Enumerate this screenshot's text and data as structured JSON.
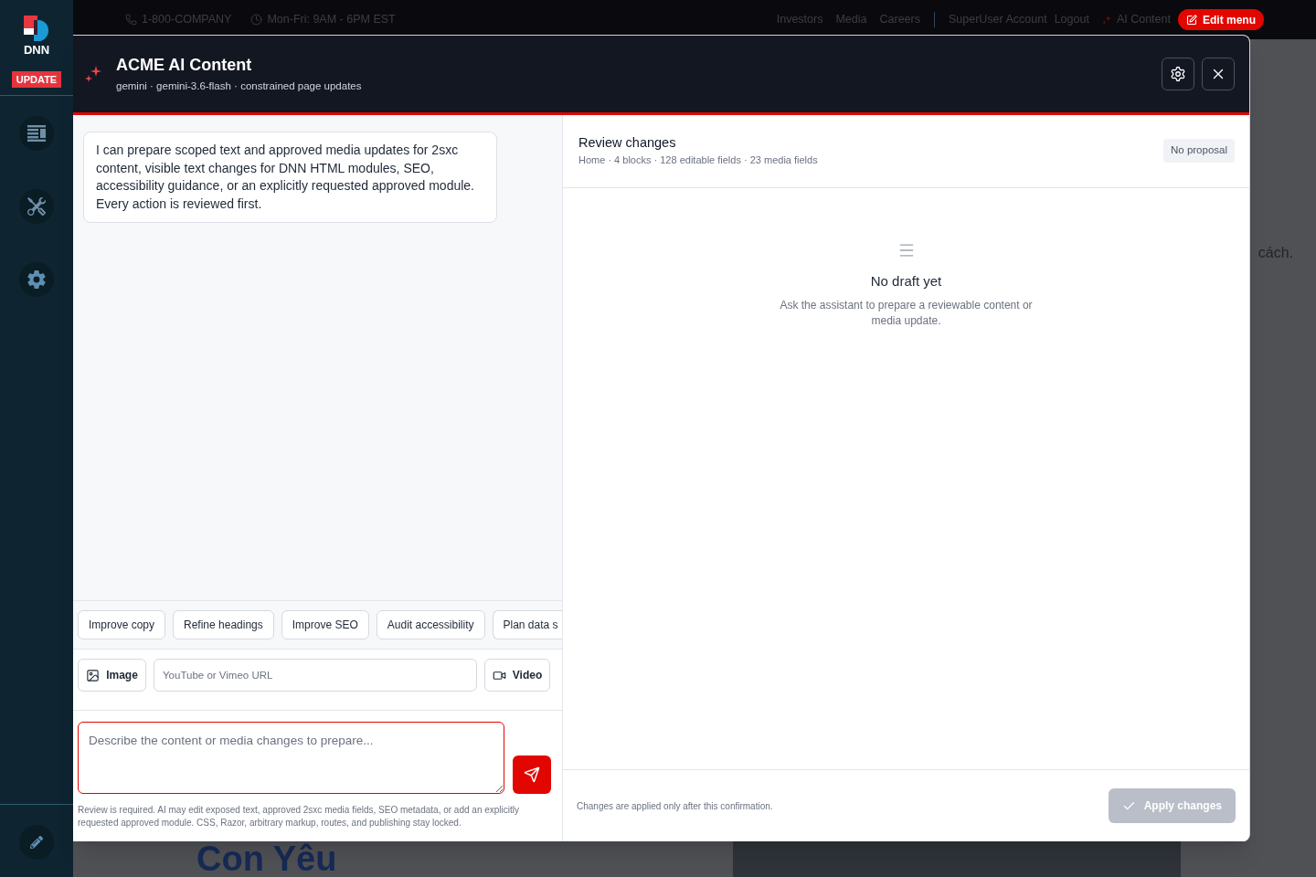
{
  "top_bar": {
    "contact": [
      {
        "kind": "phone",
        "text": "1-800-COMPANY"
      },
      {
        "kind": "hours",
        "text": "Mon-Fri: 9AM - 6PM EST"
      }
    ],
    "nav_links": [
      "Investors",
      "Media",
      "Careers"
    ],
    "account_links": [
      "SuperUser Account",
      "Logout"
    ],
    "ai_link": "AI Content",
    "edit_button": "Edit menu"
  },
  "sidebar": {
    "logo_text": "DNN",
    "badge": "UPDATE"
  },
  "modal": {
    "title": "ACME AI Content",
    "subtitle": "gemini · gemini-3.6-flash · constrained page updates"
  },
  "chat": {
    "messages": [
      "I can prepare scoped text and approved media updates for 2sxc content, visible text changes for DNN HTML modules, SEO, accessibility guidance, or an explicitly requested approved module. Every action is reviewed first."
    ],
    "suggestions": [
      "Improve copy",
      "Refine headings",
      "Improve SEO",
      "Audit accessibility",
      "Plan data s"
    ],
    "media": {
      "image_button": "Image",
      "url_field": {
        "placeholder": "YouTube or Vimeo URL"
      },
      "video_button": "Video"
    },
    "prompt": {
      "placeholder": "Describe the content or media changes to prepare..."
    },
    "notice": "Review is required. AI may edit exposed text, approved 2sxc media fields, SEO metadata, or add an explicitly requested approved module. CSS, Razor, arbitrary markup, routes, and publishing stay locked."
  },
  "review": {
    "title": "Review changes",
    "summary": "Home · 4 blocks · 128 editable fields · 23 media fields",
    "status": "No proposal",
    "empty": {
      "title": "No draft yet",
      "text": "Ask the assistant to prepare a reviewable content or media update."
    },
    "footer_note": "Changes are applied only after this confirmation.",
    "apply_button": {
      "label": "Apply changes",
      "disabled": true
    }
  },
  "background_page": {
    "text_fragment": "cách.",
    "heading": "Con Yêu"
  }
}
